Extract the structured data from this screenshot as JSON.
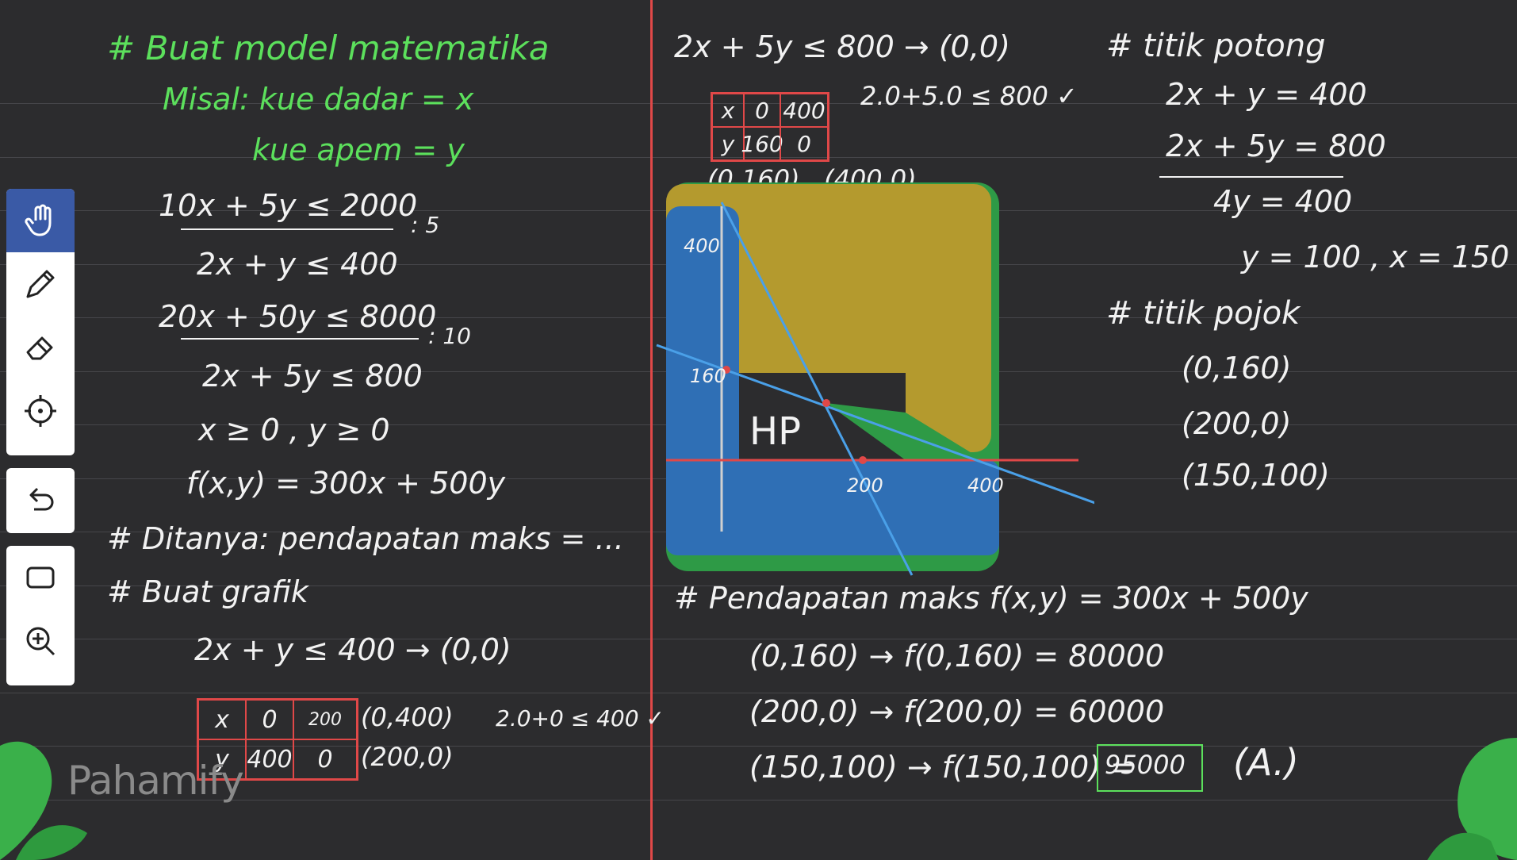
{
  "toolbar": {
    "tools": [
      "hand-tool",
      "pen-tool",
      "eraser-tool",
      "laser-pointer-tool",
      "undo-tool",
      "shape-tool",
      "zoom-tool"
    ],
    "active": "hand-tool"
  },
  "colors": {
    "background": "#2c2c2e",
    "marker_green": "#5ce05c",
    "marker_white": "#f2f2f2",
    "margin_red": "#e04848",
    "region_yellow": "#b49a2e",
    "region_blue": "#2f6fb5",
    "region_green": "#2e9a46"
  },
  "left": {
    "h1": "# Buat model matematika",
    "misal_x": "Misal: kue dadar = x",
    "misal_y": "kue apem = y",
    "c1": "10x + 5y ≤ 2000",
    "c1_div": ": 5",
    "c1s": "2x + y ≤ 400",
    "c2": "20x + 50y ≤ 8000",
    "c2_div": ": 10",
    "c2s": "2x + 5y ≤ 800",
    "nonneg": "x ≥ 0 , y ≥ 0",
    "objective": "f(x,y) = 300x + 500y",
    "asked": "# Ditanya: pendapatan maks = ...",
    "graph": "# Buat grafik",
    "line1": "2x + y ≤ 400 → (0,0)",
    "t1": {
      "x_label": "x",
      "y_label": "y",
      "x1": "0",
      "x2": "200",
      "y1": "400",
      "y2": "0"
    },
    "pts1a": "(0,400)",
    "pts1b": "(200,0)",
    "check1": "2.0+0 ≤ 400 ✓"
  },
  "middle": {
    "line2": "2x + 5y ≤ 800 → (0,0)",
    "check2": "2.0+5.0 ≤ 800 ✓",
    "t2": {
      "x_label": "x",
      "y_label": "y",
      "x1": "0",
      "x2": "400",
      "y1": "160",
      "y2": "0"
    },
    "pts2": "(0,160) , (400,0)",
    "graph_labels": {
      "y400": "400",
      "y160": "160",
      "x200": "200",
      "x400": "400",
      "hp": "HP"
    }
  },
  "right": {
    "h_int": "# titik potong",
    "e1": "2x + y = 400",
    "e2": "2x + 5y = 800",
    "e3": "4y = 400",
    "e4": "y = 100 , x = 150",
    "h_corner": "# titik pojok",
    "p1": "(0,160)",
    "p2": "(200,0)",
    "p3": "(150,100)"
  },
  "bottom": {
    "h_max": "# Pendapatan maks  f(x,y) = 300x + 500y",
    "r1": "(0,160) → f(0,160) = 80000",
    "r2": "(200,0) → f(200,0) = 60000",
    "r3a": "(150,100) → f(150,100) =",
    "r3b": "95000",
    "answer": "(A.)"
  },
  "watermark": "Pahamify"
}
